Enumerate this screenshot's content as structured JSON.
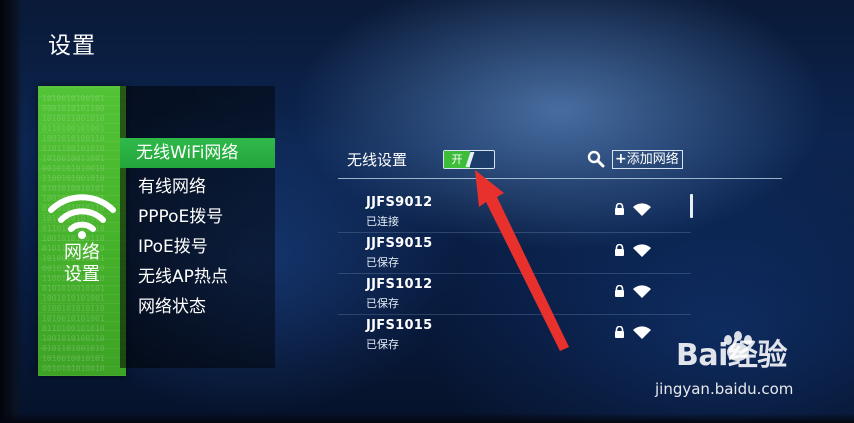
{
  "page_title": "设置",
  "tile": {
    "line1": "网络",
    "line2": "设置",
    "icon": "wifi-icon"
  },
  "menu": [
    {
      "label": "无线WiFi网络",
      "selected": true
    },
    {
      "label": "有线网络",
      "selected": false
    },
    {
      "label": "PPPoE拨号",
      "selected": false
    },
    {
      "label": "IPoE拨号",
      "selected": false
    },
    {
      "label": "无线AP热点",
      "selected": false
    },
    {
      "label": "网络状态",
      "selected": false
    }
  ],
  "wireless": {
    "label": "无线设置",
    "toggle_on_text": "开",
    "search_icon": "search-icon",
    "add_network_label": "添加网络"
  },
  "networks": [
    {
      "ssid": "JJFS9012",
      "status": "已连接"
    },
    {
      "ssid": "JJFS9015",
      "status": "已保存"
    },
    {
      "ssid": "JJFS1012",
      "status": "已保存"
    },
    {
      "ssid": "JJFS1015",
      "status": "已保存"
    }
  ],
  "watermark": {
    "brand": "Bai经验",
    "url": "jingyan.baidu.com"
  },
  "colors": {
    "tile_green": "#4cb930",
    "selected_green": "#2fb94a",
    "arrow_red": "#e8312c"
  }
}
